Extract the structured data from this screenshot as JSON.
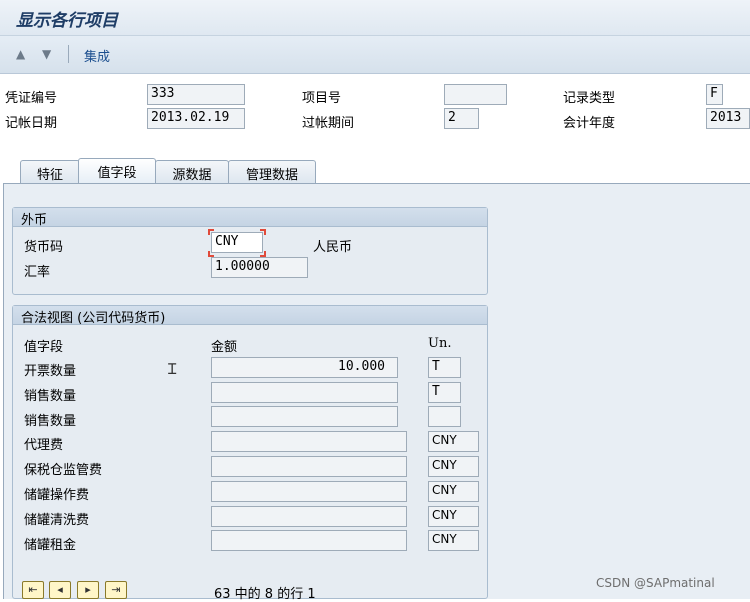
{
  "window": {
    "title": "显示各行项目"
  },
  "toolbar": {
    "up_icon": "arrow-up-icon",
    "down_icon": "arrow-down-icon",
    "integration_label": "集成"
  },
  "header": {
    "voucher_no_label": "凭证编号",
    "voucher_no": "333",
    "item_no_label": "项目号",
    "item_no": "",
    "record_type_label": "记录类型",
    "record_type": "F",
    "posting_date_label": "记帐日期",
    "posting_date": "2013.02.19",
    "posting_period_label": "过帐期间",
    "posting_period": "2",
    "fiscal_year_label": "会计年度",
    "fiscal_year": "2013"
  },
  "tabs": [
    "特征",
    "值字段",
    "源数据",
    "管理数据"
  ],
  "active_tab": "值字段",
  "foreign_currency": {
    "title": "外币",
    "currency_label": "货币码",
    "currency": "CNY",
    "currency_name": "人民币",
    "rate_label": "汇率",
    "rate": "1.00000"
  },
  "legal_view": {
    "title": "合法视图 (公司代码货币)",
    "col_field": "值字段",
    "col_amount": "金额",
    "col_unit": "Un.",
    "rows": [
      {
        "label": "开票数量",
        "amount": "10.000",
        "unit": "T"
      },
      {
        "label": "销售数量",
        "amount": "",
        "unit": "T"
      },
      {
        "label": "销售数量",
        "amount": "",
        "unit": ""
      },
      {
        "label": "代理费",
        "amount": "",
        "unit": "CNY"
      },
      {
        "label": "保税仓监管费",
        "amount": "",
        "unit": "CNY"
      },
      {
        "label": "储罐操作费",
        "amount": "",
        "unit": "CNY"
      },
      {
        "label": "储罐清洗费",
        "amount": "",
        "unit": "CNY"
      },
      {
        "label": "储罐租金",
        "amount": "",
        "unit": "CNY"
      }
    ]
  },
  "footer": {
    "page_info": "63 中的 8 的行 1",
    "nav_icons": [
      "first-page-icon",
      "previous-page-icon",
      "next-page-icon",
      "last-page-icon"
    ]
  },
  "watermark": "CSDN @SAPmatinal"
}
